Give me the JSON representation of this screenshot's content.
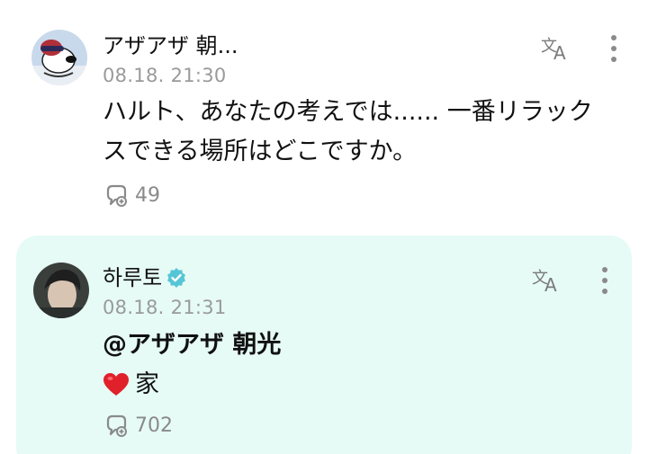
{
  "colors": {
    "reply_background": "#e6fbf6",
    "timestamp": "#9a9a9a",
    "verified_badge": "#56c6d6",
    "heart": "#e0202a"
  },
  "posts": [
    {
      "author": "アザアザ 朝...",
      "timestamp": "08.18. 21:30",
      "text_line1": "ハルト、あなたの考えでは...... 一番リラック",
      "text_line2": "スできる場所はどこですか。",
      "reaction_count": "49",
      "icons": [
        "avatar-snoopy",
        "translate-icon",
        "more-vertical-icon",
        "reaction-icon"
      ]
    },
    {
      "author": "하루토",
      "verified": true,
      "timestamp": "08.18. 21:31",
      "mention": "@アザアザ 朝光",
      "reply_emoji": "heart-emoji",
      "reply_text": "家",
      "reaction_count": "702",
      "icons": [
        "avatar-photo",
        "verified-icon",
        "translate-icon",
        "more-vertical-icon",
        "reaction-icon"
      ]
    }
  ]
}
